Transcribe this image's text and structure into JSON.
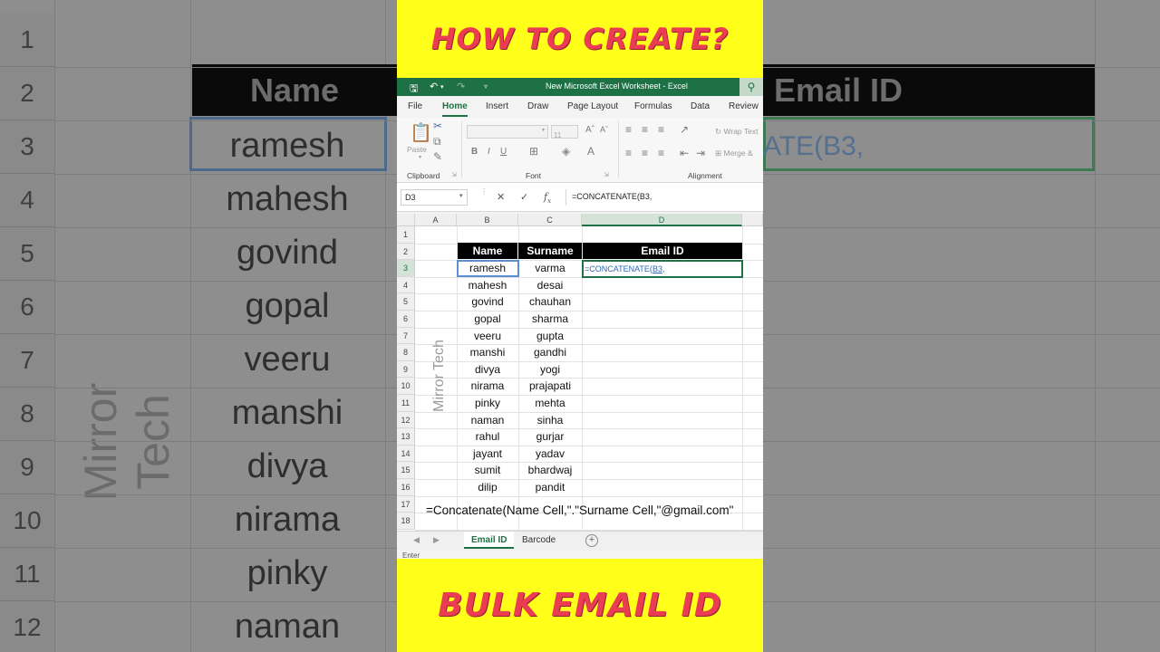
{
  "banner_top": "HOW TO CREATE?",
  "banner_bottom": "BULK EMAIL ID",
  "window_title": "New Microsoft Excel Worksheet  -  Excel",
  "ribbon_tabs": [
    "File",
    "Home",
    "Insert",
    "Draw",
    "Page Layout",
    "Formulas",
    "Data",
    "Review"
  ],
  "active_tab": "Home",
  "ribbon": {
    "paste_label": "Paste",
    "clipboard_label": "Clipboard",
    "font_label": "Font",
    "font_size": "11",
    "alignment_label": "Alignment",
    "wrap_text_label": "Wrap Text",
    "merge_label": "Merge &"
  },
  "formula_bar": {
    "name_box": "D3",
    "formula": "=CONCATENATE(B3,"
  },
  "columns": [
    "A",
    "B",
    "C",
    "D"
  ],
  "rows": [
    "1",
    "2",
    "3",
    "4",
    "5",
    "6",
    "7",
    "8",
    "9",
    "10",
    "11",
    "12",
    "13",
    "14",
    "15",
    "16",
    "17",
    "18"
  ],
  "table": {
    "headers": [
      "Name",
      "Surname",
      "Email ID"
    ],
    "names": [
      "ramesh",
      "mahesh",
      "govind",
      "gopal",
      "veeru",
      "manshi",
      "divya",
      "nirama",
      "pinky",
      "naman",
      "rahul",
      "jayant",
      "sumit",
      "dilip"
    ],
    "surnames": [
      "varma",
      "desai",
      "chauhan",
      "sharma",
      "gupta",
      "gandhi",
      "yogi",
      "prajapati",
      "mehta",
      "sinha",
      "gurjar",
      "yadav",
      "bhardwaj",
      "pandit"
    ]
  },
  "d3_formula_prefix": "=CONCATENATE(",
  "d3_formula_ref": "B3",
  "d3_formula_suffix": ",",
  "watermark": "Mirror Tech",
  "tip": "=Concatenate(Name Cell,\".\"Surname Cell,\"@gmail.com\"",
  "sheet_tabs": [
    "Email ID",
    "Barcode"
  ],
  "active_sheet": "Email ID",
  "status": "Enter",
  "background": {
    "row_numbers": [
      "1",
      "2",
      "3",
      "4",
      "5",
      "6",
      "7",
      "8",
      "9",
      "10",
      "11",
      "12"
    ],
    "name_header": "Name",
    "email_header": "Email ID",
    "names": [
      "ramesh",
      "mahesh",
      "govind",
      "gopal",
      "veeru",
      "manshi",
      "divya",
      "nirama",
      "pinky",
      "naman"
    ],
    "formula_fragment": "ATE(B3,"
  },
  "colors": {
    "banner_yellow": "#ffff19",
    "banner_text": "#ea3c53",
    "excel_green": "#1e7145",
    "header_black": "#000000"
  }
}
